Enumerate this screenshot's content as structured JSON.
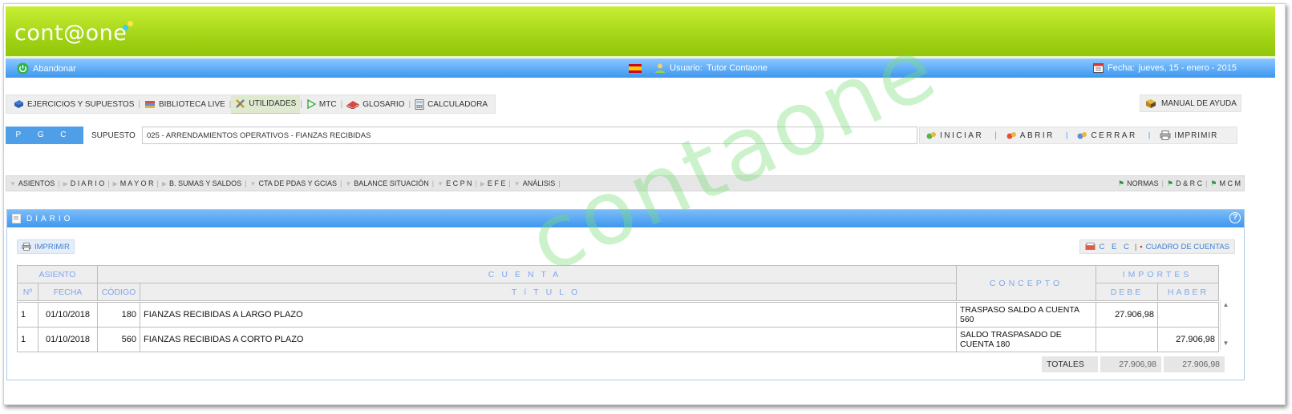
{
  "brand": {
    "logo_text": "cont@one"
  },
  "topbar": {
    "leave_label": "Abandonar",
    "user_label": "Usuario:",
    "user_name": "Tutor Contaone",
    "date_label": "Fecha:",
    "date_value": "jueves, 15 - enero - 2015"
  },
  "toolbar": {
    "items": [
      {
        "label": "EJERCICIOS Y SUPUESTOS",
        "icon": "book-icon"
      },
      {
        "label": "BIBLIOTECA LIVE",
        "icon": "books-icon"
      },
      {
        "label": "UTILIDADES",
        "icon": "tools-icon"
      },
      {
        "label": "MTC",
        "icon": "play-icon"
      },
      {
        "label": "GLOSARIO",
        "icon": "glossary-icon"
      },
      {
        "label": "CALCULADORA",
        "icon": "calculator-icon"
      }
    ],
    "help_label": "MANUAL DE AYUDA"
  },
  "supuesto": {
    "tab_label": "P G C",
    "label": "SUPUESTO",
    "value": "025 - ARRENDAMIENTOS OPERATIVOS - FIANZAS RECIBIDAS"
  },
  "actions": {
    "iniciar": "INICIAR",
    "abrir": "ABRIR",
    "cerrar": "CERRAR",
    "imprimir": "IMPRIMIR"
  },
  "menu": {
    "left": [
      "ASIENTOS",
      "D I A R I O",
      "M A Y O R",
      "B. SUMAS Y SALDOS",
      "CTA DE PDAS Y GCIAS",
      "BALANCE SITUACIÓN",
      "E C P N",
      "E F E",
      "ANÁLISIS"
    ],
    "right": [
      "NORMAS",
      "D & R C",
      "M C M"
    ]
  },
  "panel": {
    "title": "DIARIO",
    "print_label": "IMPRIMIR",
    "cec_label": "C E C",
    "cuadro_label": "CUADRO DE CUENTAS"
  },
  "table": {
    "header": {
      "asiento": "ASIENTO",
      "cuenta": "CUENTA",
      "concepto": "CONCEPTO",
      "importes": "IMPORTES",
      "n": "Nº",
      "fecha": "FECHA",
      "codigo": "CÓDIGO",
      "titulo": "TíTULO",
      "debe": "DEBE",
      "haber": "HABER"
    },
    "rows": [
      {
        "n": "1",
        "fecha": "01/10/2018",
        "codigo": "180",
        "titulo": "FIANZAS RECIBIDAS A LARGO PLAZO",
        "concepto": "TRASPASO SALDO A CUENTA 560",
        "debe": "27.906,98",
        "haber": ""
      },
      {
        "n": "1",
        "fecha": "01/10/2018",
        "codigo": "560",
        "titulo": "FIANZAS RECIBIDAS A CORTO PLAZO",
        "concepto": "SALDO TRASPASADO DE CUENTA 180",
        "debe": "",
        "haber": "27.906,98"
      }
    ],
    "totals": {
      "label": "TOTALES",
      "debe": "27.906,98",
      "haber": "27.906,98"
    }
  },
  "watermark": "contaone"
}
